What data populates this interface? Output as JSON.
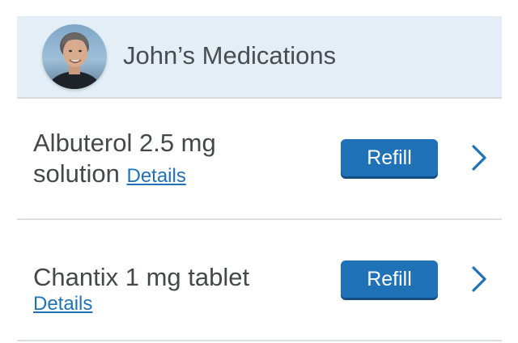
{
  "header": {
    "title": "John’s Medications"
  },
  "medications": [
    {
      "name_line1": "Albuterol 2.5 mg",
      "name_line2": "solution",
      "details_label": "Details",
      "refill_label": "Refill"
    },
    {
      "name_line1": "Chantix 1 mg tablet",
      "details_label": "Details",
      "refill_label": "Refill"
    }
  ],
  "colors": {
    "header_bg": "#e3eef7",
    "accent_blue": "#1f72b8",
    "text_dark": "#45484b"
  },
  "icons": {
    "avatar": "user-photo",
    "row_chevron": "chevron-right-icon"
  }
}
